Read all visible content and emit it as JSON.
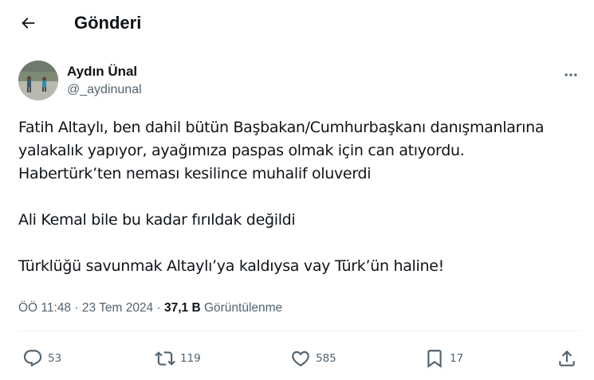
{
  "header": {
    "title": "Gönderi",
    "back_icon": "arrow-left-icon"
  },
  "author": {
    "name": "Aydın Ünal",
    "handle": "@_aydinunal"
  },
  "tweet": {
    "lines": [
      "Fatih Altaylı, ben dahil bütün Başbakan/Cumhurbaşkanı danışmanlarına",
      "yalakalık yapıyor, ayağımıza paspas olmak için can atıyordu.",
      "Habertürk’ten neması kesilince muhalif oluverdi",
      "Ali Kemal bile bu kadar fırıldak değildi",
      "Türklüğü savunmak Altaylı’ya kaldıysa vay Türk’ün haline!"
    ]
  },
  "meta": {
    "time": "ÖÖ 11:48",
    "separator": " · ",
    "date": "23 Tem 2024",
    "views_count": "37,1 B",
    "views_label": " Görüntülenme"
  },
  "actions": {
    "replies": "53",
    "reposts": "119",
    "likes": "585",
    "bookmarks": "17"
  },
  "colors": {
    "text": "#0f1419",
    "secondary": "#536471",
    "divider": "#eff3f4"
  }
}
